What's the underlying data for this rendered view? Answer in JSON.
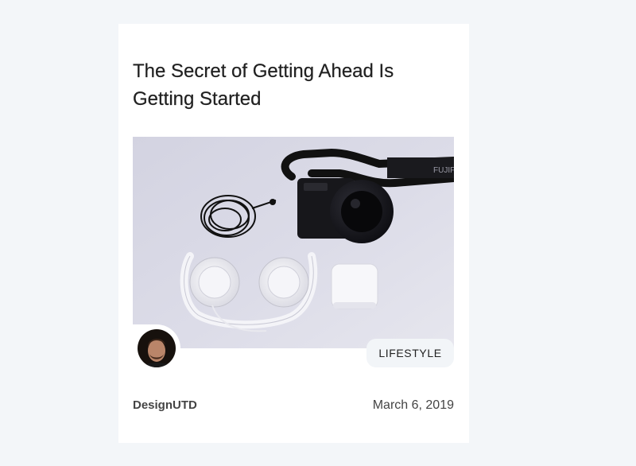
{
  "post": {
    "title": "The Secret of Getting Ahead Is Getting Started",
    "category": "LIFESTYLE",
    "author": "DesignUTD",
    "date": "March 6, 2019",
    "camera_brand_text": "FUJIFILM"
  },
  "colors": {
    "page_background": "#f3f6f9",
    "card_background": "#ffffff",
    "badge_background": "#f2f5f8",
    "title_text": "#212121",
    "meta_text": "#444444"
  }
}
